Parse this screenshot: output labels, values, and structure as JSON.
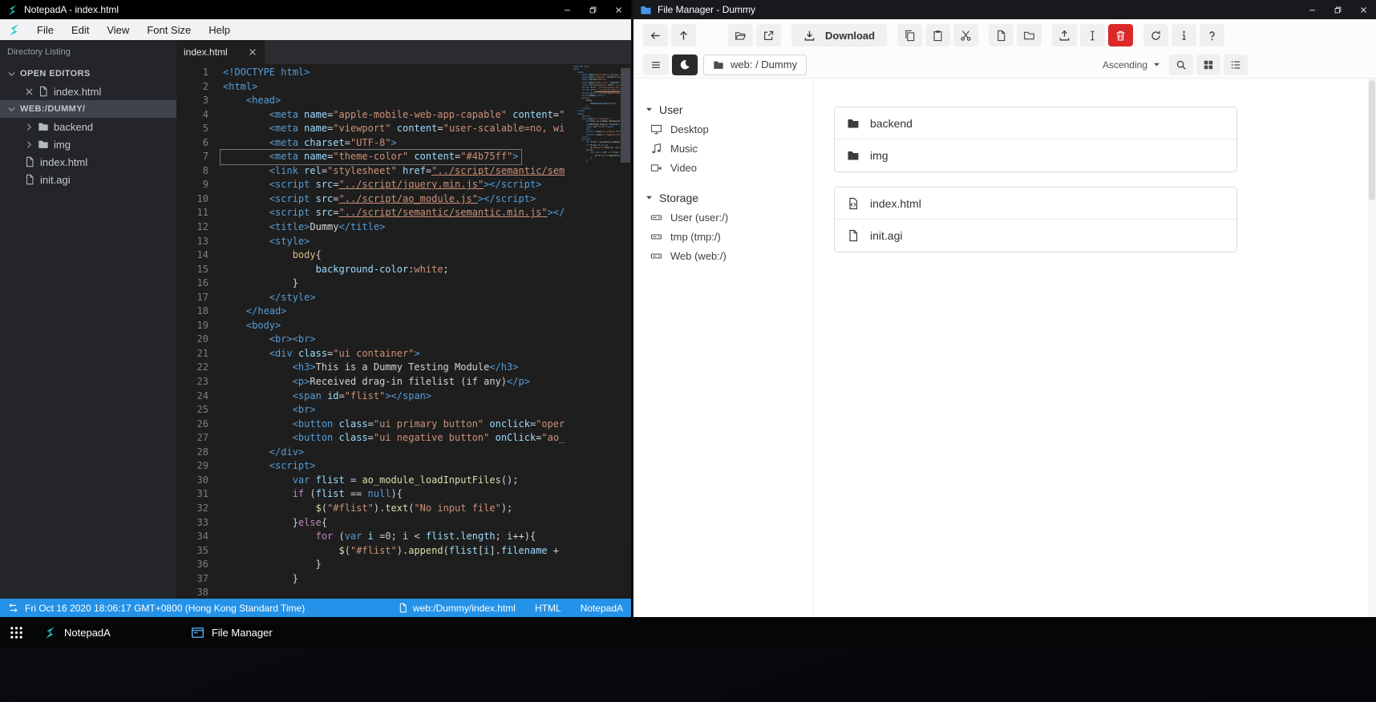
{
  "notepad": {
    "window_title": "NotepadA - index.html",
    "menu": [
      "File",
      "Edit",
      "View",
      "Font Size",
      "Help"
    ],
    "sidebar": {
      "header": "Directory Listing",
      "sections": [
        {
          "label": "OPEN EDITORS",
          "rows": [
            {
              "label": "index.html",
              "icon": "file",
              "close": true
            }
          ]
        },
        {
          "label": "WEB:/DUMMY/",
          "selected": true,
          "rows": [
            {
              "label": "backend",
              "icon": "folder-fill",
              "caret": true
            },
            {
              "label": "img",
              "icon": "folder-fill",
              "caret": true
            },
            {
              "label": "index.html",
              "icon": "file"
            },
            {
              "label": "init.agi",
              "icon": "file"
            }
          ]
        }
      ]
    },
    "tab": "index.html",
    "editor": {
      "active_line": 7,
      "lines": [
        [
          [
            "tg",
            "<!DOCTYPE html>"
          ]
        ],
        [
          [
            "tg",
            "<html>"
          ]
        ],
        [
          [
            "df",
            "    "
          ],
          [
            "tg",
            "<head>"
          ]
        ],
        [
          [
            "df",
            "        "
          ],
          [
            "tg",
            "<meta"
          ],
          [
            "df",
            " "
          ],
          [
            "at",
            "name"
          ],
          [
            "df",
            "="
          ],
          [
            "st",
            "\"apple-mobile-web-app-capable\""
          ],
          [
            "df",
            " "
          ],
          [
            "at",
            "content"
          ],
          [
            "df",
            "="
          ],
          [
            "st",
            "\""
          ]
        ],
        [
          [
            "df",
            "        "
          ],
          [
            "tg",
            "<meta"
          ],
          [
            "df",
            " "
          ],
          [
            "at",
            "name"
          ],
          [
            "df",
            "="
          ],
          [
            "st",
            "\"viewport\""
          ],
          [
            "df",
            " "
          ],
          [
            "at",
            "content"
          ],
          [
            "df",
            "="
          ],
          [
            "st",
            "\"user-scalable=no, wi"
          ]
        ],
        [
          [
            "df",
            "        "
          ],
          [
            "tg",
            "<meta"
          ],
          [
            "df",
            " "
          ],
          [
            "at",
            "charset"
          ],
          [
            "df",
            "="
          ],
          [
            "st",
            "\"UTF-8\""
          ],
          [
            "tg",
            ">"
          ]
        ],
        [
          [
            "df",
            "        "
          ],
          [
            "tg",
            "<meta"
          ],
          [
            "df",
            " "
          ],
          [
            "at",
            "name"
          ],
          [
            "df",
            "="
          ],
          [
            "st",
            "\"theme-color\""
          ],
          [
            "df",
            " "
          ],
          [
            "at",
            "content"
          ],
          [
            "df",
            "="
          ],
          [
            "st",
            "\"#4b75ff\""
          ],
          [
            "tg",
            ">"
          ]
        ],
        [
          [
            "df",
            "        "
          ],
          [
            "tg",
            "<link"
          ],
          [
            "df",
            " "
          ],
          [
            "at",
            "rel"
          ],
          [
            "df",
            "="
          ],
          [
            "st",
            "\"stylesheet\""
          ],
          [
            "df",
            " "
          ],
          [
            "at",
            "href"
          ],
          [
            "df",
            "="
          ],
          [
            "stu",
            "\"../script/semantic/sem"
          ]
        ],
        [
          [
            "df",
            "        "
          ],
          [
            "tg",
            "<script"
          ],
          [
            "df",
            " "
          ],
          [
            "at",
            "src"
          ],
          [
            "df",
            "="
          ],
          [
            "stu",
            "\"../script/jquery.min.js\""
          ],
          [
            "tg",
            "></script>"
          ]
        ],
        [
          [
            "df",
            "        "
          ],
          [
            "tg",
            "<script"
          ],
          [
            "df",
            " "
          ],
          [
            "at",
            "src"
          ],
          [
            "df",
            "="
          ],
          [
            "stu",
            "\"../script/ao_module.js\""
          ],
          [
            "tg",
            "></script>"
          ]
        ],
        [
          [
            "df",
            "        "
          ],
          [
            "tg",
            "<script"
          ],
          [
            "df",
            " "
          ],
          [
            "at",
            "src"
          ],
          [
            "df",
            "="
          ],
          [
            "stu",
            "\"../script/semantic/semantic.min.js\""
          ],
          [
            "tg",
            "></"
          ]
        ],
        [
          [
            "df",
            "        "
          ],
          [
            "tg",
            "<title>"
          ],
          [
            "df",
            "Dummy"
          ],
          [
            "tg",
            "</title>"
          ]
        ],
        [
          [
            "df",
            "        "
          ],
          [
            "tg",
            "<style>"
          ]
        ],
        [
          [
            "df",
            "            "
          ],
          [
            "cs",
            "body"
          ],
          [
            "df",
            "{"
          ]
        ],
        [
          [
            "df",
            "                "
          ],
          [
            "cp",
            "background-color"
          ],
          [
            "df",
            ":"
          ],
          [
            "st",
            "white"
          ],
          [
            "df",
            ";"
          ]
        ],
        [
          [
            "df",
            "            }"
          ]
        ],
        [
          [
            "df",
            "        "
          ],
          [
            "tg",
            "</style>"
          ]
        ],
        [
          [
            "df",
            "    "
          ],
          [
            "tg",
            "</head>"
          ]
        ],
        [
          [
            "df",
            "    "
          ],
          [
            "tg",
            "<body>"
          ]
        ],
        [
          [
            "df",
            "        "
          ],
          [
            "tg",
            "<br><br>"
          ]
        ],
        [
          [
            "df",
            "        "
          ],
          [
            "tg",
            "<div"
          ],
          [
            "df",
            " "
          ],
          [
            "at",
            "class"
          ],
          [
            "df",
            "="
          ],
          [
            "st",
            "\"ui container\""
          ],
          [
            "tg",
            ">"
          ]
        ],
        [
          [
            "df",
            "            "
          ],
          [
            "tg",
            "<h3>"
          ],
          [
            "df",
            "This is a Dummy Testing Module"
          ],
          [
            "tg",
            "</h3>"
          ]
        ],
        [
          [
            "df",
            "            "
          ],
          [
            "tg",
            "<p>"
          ],
          [
            "df",
            "Received drag-in filelist (if any)"
          ],
          [
            "tg",
            "</p>"
          ]
        ],
        [
          [
            "df",
            "            "
          ],
          [
            "tg",
            "<span"
          ],
          [
            "df",
            " "
          ],
          [
            "at",
            "id"
          ],
          [
            "df",
            "="
          ],
          [
            "st",
            "\"flist\""
          ],
          [
            "tg",
            "></span>"
          ]
        ],
        [
          [
            "df",
            "            "
          ],
          [
            "tg",
            "<br>"
          ]
        ],
        [
          [
            "df",
            "            "
          ],
          [
            "tg",
            "<button"
          ],
          [
            "df",
            " "
          ],
          [
            "at",
            "class"
          ],
          [
            "df",
            "="
          ],
          [
            "st",
            "\"ui primary button\""
          ],
          [
            "df",
            " "
          ],
          [
            "at",
            "onclick"
          ],
          [
            "df",
            "="
          ],
          [
            "st",
            "\"oper"
          ]
        ],
        [
          [
            "df",
            "            "
          ],
          [
            "tg",
            "<button"
          ],
          [
            "df",
            " "
          ],
          [
            "at",
            "class"
          ],
          [
            "df",
            "="
          ],
          [
            "st",
            "\"ui negative button\""
          ],
          [
            "df",
            " "
          ],
          [
            "at",
            "onClick"
          ],
          [
            "df",
            "="
          ],
          [
            "st",
            "\"ao_"
          ]
        ],
        [
          [
            "df",
            "        "
          ],
          [
            "tg",
            "</div>"
          ]
        ],
        [
          [
            "df",
            "        "
          ],
          [
            "tg",
            "<script>"
          ]
        ],
        [
          [
            "df",
            "            "
          ],
          [
            "kb",
            "var"
          ],
          [
            "df",
            " "
          ],
          [
            "vr",
            "flist"
          ],
          [
            "df",
            " = "
          ],
          [
            "fn",
            "ao_module_loadInputFiles"
          ],
          [
            "df",
            "();"
          ]
        ],
        [
          [
            "df",
            "            "
          ],
          [
            "kp",
            "if"
          ],
          [
            "df",
            " ("
          ],
          [
            "vr",
            "flist"
          ],
          [
            "df",
            " == "
          ],
          [
            "kb",
            "null"
          ],
          [
            "df",
            "){"
          ]
        ],
        [
          [
            "df",
            "                "
          ],
          [
            "fn",
            "$"
          ],
          [
            "df",
            "("
          ],
          [
            "st",
            "\"#flist\""
          ],
          [
            "df",
            ")."
          ],
          [
            "fn",
            "text"
          ],
          [
            "df",
            "("
          ],
          [
            "st",
            "\"No input file\""
          ],
          [
            "df",
            ");"
          ]
        ],
        [
          [
            "df",
            "            }"
          ],
          [
            "kp",
            "else"
          ],
          [
            "df",
            "{"
          ]
        ],
        [
          [
            "df",
            "                "
          ],
          [
            "kp",
            "for"
          ],
          [
            "df",
            " ("
          ],
          [
            "kb",
            "var"
          ],
          [
            "df",
            " "
          ],
          [
            "vr",
            "i"
          ],
          [
            "df",
            " ="
          ],
          [
            "nm",
            "0"
          ],
          [
            "df",
            "; "
          ],
          [
            "vr",
            "i"
          ],
          [
            "df",
            " < "
          ],
          [
            "vr",
            "flist"
          ],
          [
            "df",
            "."
          ],
          [
            "vr",
            "length"
          ],
          [
            "df",
            "; "
          ],
          [
            "vr",
            "i"
          ],
          [
            "df",
            "++){"
          ]
        ],
        [
          [
            "df",
            "                    "
          ],
          [
            "fn",
            "$"
          ],
          [
            "df",
            "("
          ],
          [
            "st",
            "\"#flist\""
          ],
          [
            "df",
            ")."
          ],
          [
            "fn",
            "append"
          ],
          [
            "df",
            "("
          ],
          [
            "vr",
            "flist"
          ],
          [
            "df",
            "["
          ],
          [
            "vr",
            "i"
          ],
          [
            "df",
            "]."
          ],
          [
            "vr",
            "filename"
          ],
          [
            "df",
            " + "
          ]
        ],
        [
          [
            "df",
            "                }"
          ]
        ],
        [
          [
            "df",
            "            }"
          ]
        ],
        []
      ]
    },
    "statusbar": {
      "left": "Fri Oct 16 2020 18:06:17 GMT+0800 (Hong Kong Standard Time)",
      "path": "web:/Dummy/index.html",
      "lang": "HTML",
      "app": "NotepadA"
    }
  },
  "filemanager": {
    "window_title": "File Manager - Dummy",
    "toolbar": {
      "groups": [
        [
          {
            "icon": "arrow-left",
            "name": "back"
          },
          {
            "icon": "arrow-up",
            "name": "up"
          }
        ],
        [
          {
            "icon": "folder-open",
            "name": "open"
          },
          {
            "icon": "external",
            "name": "open-in-new-window"
          }
        ],
        [
          {
            "icon": "download",
            "label": "Download",
            "name": "download"
          }
        ],
        [
          {
            "icon": "copy",
            "name": "copy"
          },
          {
            "icon": "paste",
            "name": "paste"
          },
          {
            "icon": "cut",
            "name": "cut"
          }
        ],
        [
          {
            "icon": "file",
            "name": "new-file"
          },
          {
            "icon": "folder",
            "name": "new-folder"
          }
        ],
        [
          {
            "icon": "upload",
            "name": "upload"
          },
          {
            "icon": "i-cursor",
            "name": "rename"
          },
          {
            "icon": "trash",
            "name": "delete",
            "style": "danger"
          }
        ],
        [
          {
            "icon": "refresh",
            "name": "refresh"
          },
          {
            "icon": "info",
            "name": "properties"
          },
          {
            "icon": "question",
            "name": "help"
          }
        ]
      ]
    },
    "breadcrumb": "web: / Dummy",
    "sort": "Ascending",
    "sidebar": {
      "groups": [
        {
          "label": "User",
          "items": [
            {
              "label": "Desktop",
              "icon": "desktop"
            },
            {
              "label": "Music",
              "icon": "music"
            },
            {
              "label": "Video",
              "icon": "video"
            }
          ]
        },
        {
          "label": "Storage",
          "items": [
            {
              "label": "User (user:/)",
              "icon": "disk"
            },
            {
              "label": "tmp (tmp:/)",
              "icon": "disk"
            },
            {
              "label": "Web (web:/)",
              "icon": "disk"
            }
          ]
        }
      ]
    },
    "files": {
      "groups": [
        [
          {
            "name": "backend",
            "icon": "folder-fill"
          },
          {
            "name": "img",
            "icon": "folder-fill"
          }
        ],
        [
          {
            "name": "index.html",
            "icon": "file-code"
          },
          {
            "name": "init.agi",
            "icon": "file"
          }
        ]
      ]
    }
  },
  "taskbar": {
    "apps": [
      {
        "label": "NotepadA",
        "icon": "notepada-logo"
      },
      {
        "label": "File Manager",
        "icon": "fm-window"
      }
    ]
  },
  "colors": {
    "statusbar_blue": "#2492e8",
    "accent_teal": "#23c6c8",
    "danger_red": "#db2828",
    "editor_bg": "#1e1e1e",
    "np_titlebar": "#000000",
    "fm_titlebar": "#17191c"
  }
}
